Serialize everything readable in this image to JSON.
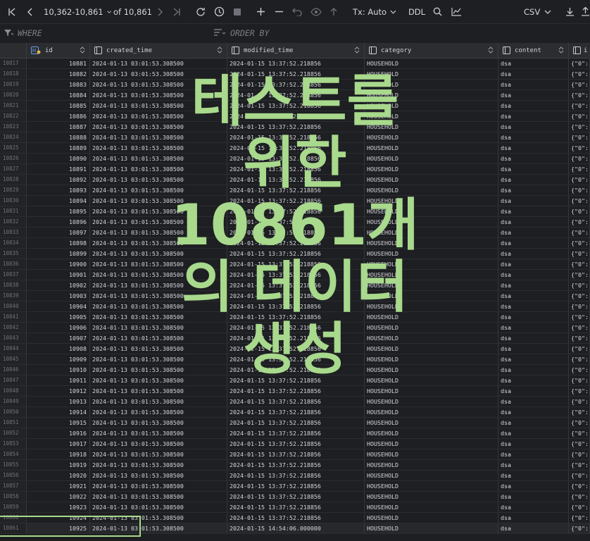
{
  "toolbar": {
    "page_range": "10,362-10,861",
    "of_total": "of 10,861",
    "tx_mode": "Tx: Auto",
    "ddl_label": "DDL",
    "export_format": "CSV"
  },
  "filter": {
    "where_label": "WHERE",
    "order_label": "ORDER BY"
  },
  "columns": [
    "id",
    "created_time",
    "modified_time",
    "category",
    "content",
    "i"
  ],
  "rows": [
    {
      "n": "10817",
      "id": "10881",
      "c": "2024-01-13 03:01:53.308500",
      "m": "2024-01-15 13:37:52.218856",
      "cat": "HOUSEHOLD",
      "content": "dsa",
      "extra": "{\"0\":"
    },
    {
      "n": "10818",
      "id": "10882",
      "c": "2024-01-13 03:01:53.308500",
      "m": "2024-01-15 13:37:52.218856",
      "cat": "HOUSEHOLD",
      "content": "dsa",
      "extra": "{\"0\":"
    },
    {
      "n": "10819",
      "id": "10883",
      "c": "2024-01-13 03:01:53.308500",
      "m": "2024-01-15 13:37:52.218856",
      "cat": "HOUSEHOLD",
      "content": "dsa",
      "extra": "{\"0\":"
    },
    {
      "n": "10820",
      "id": "10884",
      "c": "2024-01-13 03:01:53.308500",
      "m": "2024-01-15 13:37:52.218856",
      "cat": "HOUSEHOLD",
      "content": "dsa",
      "extra": "{\"0\":"
    },
    {
      "n": "10821",
      "id": "10885",
      "c": "2024-01-13 03:01:53.308500",
      "m": "2024-01-15 13:37:52.218856",
      "cat": "HOUSEHOLD",
      "content": "dsa",
      "extra": "{\"0\":"
    },
    {
      "n": "10822",
      "id": "10886",
      "c": "2024-01-13 03:01:53.308500",
      "m": "2024-01-15 13:37:52.218856",
      "cat": "HOUSEHOLD",
      "content": "dsa",
      "extra": "{\"0\":"
    },
    {
      "n": "10823",
      "id": "10887",
      "c": "2024-01-13 03:01:53.308500",
      "m": "2024-01-15 13:37:52.218856",
      "cat": "HOUSEHOLD",
      "content": "dsa",
      "extra": "{\"0\":"
    },
    {
      "n": "10824",
      "id": "10888",
      "c": "2024-01-13 03:01:53.308500",
      "m": "2024-01-15 13:37:52.218856",
      "cat": "HOUSEHOLD",
      "content": "dsa",
      "extra": "{\"0\":"
    },
    {
      "n": "10825",
      "id": "10889",
      "c": "2024-01-13 03:01:53.308500",
      "m": "2024-01-15 13:37:52.218856",
      "cat": "HOUSEHOLD",
      "content": "dsa",
      "extra": "{\"0\":"
    },
    {
      "n": "10826",
      "id": "10890",
      "c": "2024-01-13 03:01:53.308500",
      "m": "2024-01-15 13:37:52.218856",
      "cat": "HOUSEHOLD",
      "content": "dsa",
      "extra": "{\"0\":"
    },
    {
      "n": "10827",
      "id": "10891",
      "c": "2024-01-13 03:01:53.308500",
      "m": "2024-01-15 13:37:52.218856",
      "cat": "HOUSEHOLD",
      "content": "dsa",
      "extra": "{\"0\":"
    },
    {
      "n": "10828",
      "id": "10892",
      "c": "2024-01-13 03:01:53.308500",
      "m": "2024-01-15 13:37:52.218856",
      "cat": "HOUSEHOLD",
      "content": "dsa",
      "extra": "{\"0\":"
    },
    {
      "n": "10829",
      "id": "10893",
      "c": "2024-01-13 03:01:53.308500",
      "m": "2024-01-15 13:37:52.218856",
      "cat": "HOUSEHOLD",
      "content": "dsa",
      "extra": "{\"0\":"
    },
    {
      "n": "10830",
      "id": "10894",
      "c": "2024-01-13 03:01:53.308500",
      "m": "2024-01-15 13:37:52.218856",
      "cat": "HOUSEHOLD",
      "content": "dsa",
      "extra": "{\"0\":"
    },
    {
      "n": "10831",
      "id": "10895",
      "c": "2024-01-13 03:01:53.308500",
      "m": "2024-01-15 13:37:52.218856",
      "cat": "HOUSEHOLD",
      "content": "dsa",
      "extra": "{\"0\":"
    },
    {
      "n": "10832",
      "id": "10896",
      "c": "2024-01-13 03:01:53.308500",
      "m": "2024-01-15 13:37:52.218856",
      "cat": "HOUSEHOLD",
      "content": "dsa",
      "extra": "{\"0\":"
    },
    {
      "n": "10833",
      "id": "10897",
      "c": "2024-01-13 03:01:53.308500",
      "m": "2024-01-15 13:37:52.218856",
      "cat": "HOUSEHOLD",
      "content": "dsa",
      "extra": "{\"0\":"
    },
    {
      "n": "10834",
      "id": "10898",
      "c": "2024-01-13 03:01:53.308500",
      "m": "2024-01-15 13:37:52.218856",
      "cat": "HOUSEHOLD",
      "content": "dsa",
      "extra": "{\"0\":"
    },
    {
      "n": "10835",
      "id": "10899",
      "c": "2024-01-13 03:01:53.308500",
      "m": "2024-01-15 13:37:52.218856",
      "cat": "HOUSEHOLD",
      "content": "dsa",
      "extra": "{\"0\":"
    },
    {
      "n": "10836",
      "id": "10900",
      "c": "2024-01-13 03:01:53.308500",
      "m": "2024-01-15 13:37:52.218856",
      "cat": "HOUSEHOLD",
      "content": "dsa",
      "extra": "{\"0\":"
    },
    {
      "n": "10837",
      "id": "10901",
      "c": "2024-01-13 03:01:53.308500",
      "m": "2024-01-15 13:37:52.218856",
      "cat": "HOUSEHOLD",
      "content": "dsa",
      "extra": "{\"0\":"
    },
    {
      "n": "10838",
      "id": "10902",
      "c": "2024-01-13 03:01:53.308500",
      "m": "2024-01-15 13:37:52.218856",
      "cat": "HOUSEHOLD",
      "content": "dsa",
      "extra": "{\"0\":"
    },
    {
      "n": "10839",
      "id": "10903",
      "c": "2024-01-13 03:01:53.308500",
      "m": "2024-01-15 13:37:52.218856",
      "cat": "HOUSEHOLD",
      "content": "dsa",
      "extra": "{\"0\":"
    },
    {
      "n": "10840",
      "id": "10904",
      "c": "2024-01-13 03:01:53.308500",
      "m": "2024-01-15 13:37:52.218856",
      "cat": "HOUSEHOLD",
      "content": "dsa",
      "extra": "{\"0\":"
    },
    {
      "n": "10841",
      "id": "10905",
      "c": "2024-01-13 03:01:53.308500",
      "m": "2024-01-15 13:37:52.218856",
      "cat": "HOUSEHOLD",
      "content": "dsa",
      "extra": "{\"0\":"
    },
    {
      "n": "10842",
      "id": "10906",
      "c": "2024-01-13 03:01:53.308500",
      "m": "2024-01-15 13:37:52.218856",
      "cat": "HOUSEHOLD",
      "content": "dsa",
      "extra": "{\"0\":"
    },
    {
      "n": "10843",
      "id": "10907",
      "c": "2024-01-13 03:01:53.308500",
      "m": "2024-01-15 13:37:52.218856",
      "cat": "HOUSEHOLD",
      "content": "dsa",
      "extra": "{\"0\":"
    },
    {
      "n": "10844",
      "id": "10908",
      "c": "2024-01-13 03:01:53.308500",
      "m": "2024-01-15 13:37:52.218856",
      "cat": "HOUSEHOLD",
      "content": "dsa",
      "extra": "{\"0\":"
    },
    {
      "n": "10845",
      "id": "10909",
      "c": "2024-01-13 03:01:53.308500",
      "m": "2024-01-15 13:37:52.218856",
      "cat": "HOUSEHOLD",
      "content": "dsa",
      "extra": "{\"0\":"
    },
    {
      "n": "10846",
      "id": "10910",
      "c": "2024-01-13 03:01:53.308500",
      "m": "2024-01-15 13:37:52.218856",
      "cat": "HOUSEHOLD",
      "content": "dsa",
      "extra": "{\"0\":"
    },
    {
      "n": "10847",
      "id": "10911",
      "c": "2024-01-13 03:01:53.308500",
      "m": "2024-01-15 13:37:52.218856",
      "cat": "HOUSEHOLD",
      "content": "dsa",
      "extra": "{\"0\":"
    },
    {
      "n": "10848",
      "id": "10912",
      "c": "2024-01-13 03:01:53.308500",
      "m": "2024-01-15 13:37:52.218856",
      "cat": "HOUSEHOLD",
      "content": "dsa",
      "extra": "{\"0\":"
    },
    {
      "n": "10849",
      "id": "10913",
      "c": "2024-01-13 03:01:53.308500",
      "m": "2024-01-15 13:37:52.218856",
      "cat": "HOUSEHOLD",
      "content": "dsa",
      "extra": "{\"0\":"
    },
    {
      "n": "10850",
      "id": "10914",
      "c": "2024-01-13 03:01:53.308500",
      "m": "2024-01-15 13:37:52.218856",
      "cat": "HOUSEHOLD",
      "content": "dsa",
      "extra": "{\"0\":"
    },
    {
      "n": "10851",
      "id": "10915",
      "c": "2024-01-13 03:01:53.308500",
      "m": "2024-01-15 13:37:52.218856",
      "cat": "HOUSEHOLD",
      "content": "dsa",
      "extra": "{\"0\":"
    },
    {
      "n": "10852",
      "id": "10916",
      "c": "2024-01-13 03:01:53.308500",
      "m": "2024-01-15 13:37:52.218856",
      "cat": "HOUSEHOLD",
      "content": "dsa",
      "extra": "{\"0\":"
    },
    {
      "n": "10853",
      "id": "10917",
      "c": "2024-01-13 03:01:53.308500",
      "m": "2024-01-15 13:37:52.218856",
      "cat": "HOUSEHOLD",
      "content": "dsa",
      "extra": "{\"0\":"
    },
    {
      "n": "10854",
      "id": "10918",
      "c": "2024-01-13 03:01:53.308500",
      "m": "2024-01-15 13:37:52.218856",
      "cat": "HOUSEHOLD",
      "content": "dsa",
      "extra": "{\"0\":"
    },
    {
      "n": "10855",
      "id": "10919",
      "c": "2024-01-13 03:01:53.308500",
      "m": "2024-01-15 13:37:52.218856",
      "cat": "HOUSEHOLD",
      "content": "dsa",
      "extra": "{\"0\":"
    },
    {
      "n": "10856",
      "id": "10920",
      "c": "2024-01-13 03:01:53.308500",
      "m": "2024-01-15 13:37:52.218856",
      "cat": "HOUSEHOLD",
      "content": "dsa",
      "extra": "{\"0\":"
    },
    {
      "n": "10857",
      "id": "10921",
      "c": "2024-01-13 03:01:53.308500",
      "m": "2024-01-15 13:37:52.218856",
      "cat": "HOUSEHOLD",
      "content": "dsa",
      "extra": "{\"0\":"
    },
    {
      "n": "10858",
      "id": "10922",
      "c": "2024-01-13 03:01:53.308500",
      "m": "2024-01-15 13:37:52.218856",
      "cat": "HOUSEHOLD",
      "content": "dsa",
      "extra": "{\"0\":"
    },
    {
      "n": "10859",
      "id": "10923",
      "c": "2024-01-13 03:01:53.308500",
      "m": "2024-01-15 13:37:52.218856",
      "cat": "HOUSEHOLD",
      "content": "dsa",
      "extra": "{\"0\":"
    },
    {
      "n": "10860",
      "id": "10924",
      "c": "2024-01-13 03:01:53.308500",
      "m": "2024-01-15 13:37:52.218856",
      "cat": "HOUSEHOLD",
      "content": "dsa",
      "extra": "{\"0\":"
    },
    {
      "n": "10861",
      "id": "10925",
      "c": "2024-01-13 03:01:53.308500",
      "m": "2024-01-15 14:54:06.000000",
      "cat": "HOUSEHOLD",
      "content": "dsa",
      "extra": "{\"0\":"
    }
  ],
  "overlay_lines": [
    "테스트를",
    "위한",
    "10861개",
    "의 데이터",
    "생성"
  ],
  "colors": {
    "accent": "#a8d98c",
    "background": "#1e1f22",
    "header": "#2b2d30"
  }
}
